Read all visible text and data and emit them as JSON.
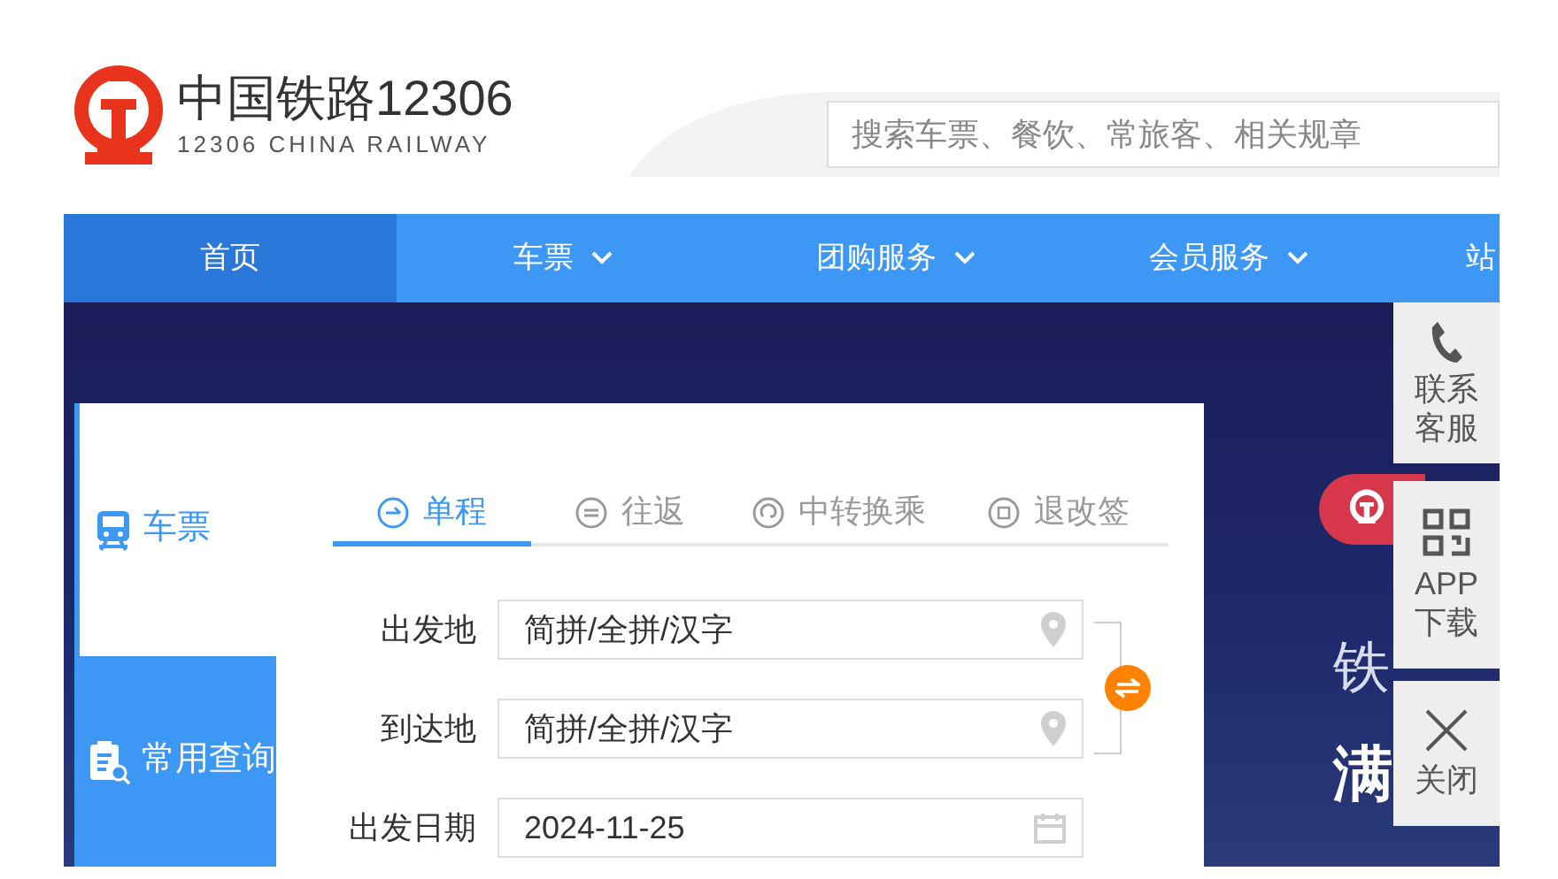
{
  "logo": {
    "title": "中国铁路12306",
    "subtitle": "12306 CHINA RAILWAY"
  },
  "search": {
    "placeholder": "搜索车票、餐饮、常旅客、相关规章"
  },
  "nav": [
    {
      "label": "首页",
      "selected": true,
      "dropdown": false
    },
    {
      "label": "车票",
      "selected": false,
      "dropdown": true
    },
    {
      "label": "团购服务",
      "selected": false,
      "dropdown": true
    },
    {
      "label": "会员服务",
      "selected": false,
      "dropdown": true
    },
    {
      "label": "站",
      "selected": false,
      "dropdown": false
    }
  ],
  "booking": {
    "side_tabs": [
      {
        "label": "车票",
        "kind": "train",
        "selected": true
      },
      {
        "label": "常用查询",
        "kind": "query",
        "selected": false
      }
    ],
    "trip_tabs": [
      {
        "label": "单程",
        "kind": "oneway",
        "selected": true
      },
      {
        "label": "往返",
        "kind": "round",
        "selected": false
      },
      {
        "label": "中转换乘",
        "kind": "transfer",
        "selected": false
      },
      {
        "label": "退改签",
        "kind": "refund",
        "selected": false
      }
    ],
    "fields": [
      {
        "label": "出发地",
        "placeholder": "简拼/全拼/汉字",
        "kind": "place"
      },
      {
        "label": "到达地",
        "placeholder": "简拼/全拼/汉字",
        "kind": "place"
      },
      {
        "label": "出发日期",
        "value": "2024-11-25",
        "kind": "date"
      }
    ]
  },
  "banner": {
    "line_1": "铁",
    "line_2": "满"
  },
  "side_panel": [
    {
      "label": "联系客服",
      "kind": "phone"
    },
    {
      "label": "APP\n下载",
      "kind": "qr"
    },
    {
      "label": "关闭",
      "kind": "close"
    }
  ]
}
